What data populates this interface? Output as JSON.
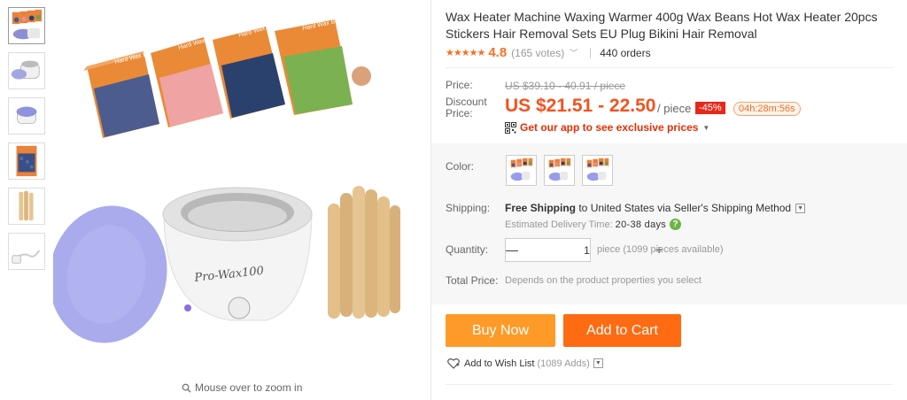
{
  "product": {
    "title": "Wax Heater Machine Waxing Warmer 400g Wax Beans Hot Wax Heater 20pcs Stickers Hair Removal Sets EU Plug Bikini Hair Removal",
    "stars": "★★★★★",
    "rating": "4.8",
    "rating_value": 4.8,
    "votes": "(165 votes)",
    "orders": "440 orders"
  },
  "gallery": {
    "thumbnails": [
      "wax-beans-bags",
      "wax-heater-open",
      "wax-heater-closed",
      "wax-beans-bag-blue",
      "wooden-sticks",
      "eu-plug-cable"
    ],
    "image_labels": {
      "bag_brand": "Hard Wax Beans",
      "heater_brand": "Pro-Wax100"
    },
    "zoom_hint": "Mouse over to zoom in"
  },
  "price": {
    "price_label": "Price:",
    "original": "US $39.10 - 40.91 / piece",
    "discount_label_line1": "Discount",
    "discount_label_line2": "Price:",
    "discount": "US $21.51 - 22.50",
    "per_piece": "/ piece",
    "percent_off": "-45%",
    "countdown": "04h:28m:56s",
    "app_promo": "Get our app to see exclusive prices"
  },
  "options": {
    "color_label": "Color:",
    "swatches": [
      "set-multicolor-1",
      "set-multicolor-2",
      "set-multicolor-3"
    ]
  },
  "shipping": {
    "label": "Shipping:",
    "free": "Free Shipping",
    "to_text": " to United States via Seller's Shipping Method",
    "eta_label": "Estimated Delivery Time:",
    "eta_value": "20-38 days",
    "help": "?"
  },
  "quantity": {
    "label": "Quantity:",
    "minus": "—",
    "value": "1",
    "plus": "+",
    "note": "piece (1099 pieces available)"
  },
  "total": {
    "label": "Total Price:",
    "note": "Depends on the product properties you select"
  },
  "actions": {
    "buy_now": "Buy Now",
    "add_to_cart": "Add to Cart",
    "wishlist": "Add to Wish List",
    "wishlist_count": "(1089 Adds)"
  },
  "colors": {
    "accent_price": "#f5521e",
    "buy_now_bg": "#fe9a27",
    "add_to_cart_bg": "#fe6b12",
    "discount_badge": "#e8271b",
    "star": "#f57224"
  }
}
